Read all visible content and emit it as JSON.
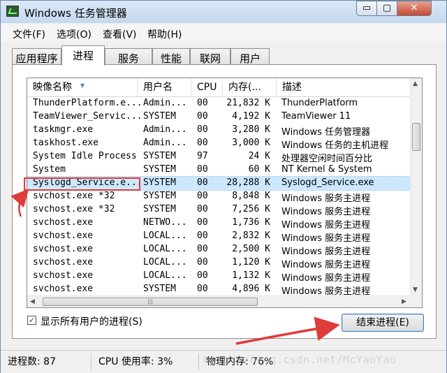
{
  "window": {
    "title": "Windows 任务管理器",
    "min_label": "▭",
    "max_label": "▢",
    "close_label": "✕"
  },
  "menu": [
    {
      "label": "文件(F)"
    },
    {
      "label": "选项(O)"
    },
    {
      "label": "查看(V)"
    },
    {
      "label": "帮助(H)"
    }
  ],
  "tabs": [
    {
      "label": "应用程序"
    },
    {
      "label": "进程",
      "active": true
    },
    {
      "label": "服务"
    },
    {
      "label": "性能"
    },
    {
      "label": "联网"
    },
    {
      "label": "用户"
    }
  ],
  "columns": [
    "映像名称",
    "用户名",
    "CPU",
    "内存(...",
    "描述"
  ],
  "processes": [
    {
      "name": "ThunderPlatform.e...",
      "user": "Admin...",
      "cpu": "00",
      "mem": "21,832 K",
      "desc": "ThunderPlatform"
    },
    {
      "name": "TeamViewer_Servic...",
      "user": "SYSTEM",
      "cpu": "00",
      "mem": "4,192 K",
      "desc": "TeamViewer 11"
    },
    {
      "name": "taskmgr.exe",
      "user": "Admin...",
      "cpu": "00",
      "mem": "3,280 K",
      "desc": "Windows 任务管理器"
    },
    {
      "name": "taskhost.exe",
      "user": "Admin...",
      "cpu": "00",
      "mem": "3,000 K",
      "desc": "Windows 任务的主机进程"
    },
    {
      "name": "System Idle Process",
      "user": "SYSTEM",
      "cpu": "97",
      "mem": "24 K",
      "desc": "处理器空闲时间百分比"
    },
    {
      "name": "System",
      "user": "SYSTEM",
      "cpu": "00",
      "mem": "60 K",
      "desc": "NT Kernel & System"
    },
    {
      "name": "Syslogd_Service.e...",
      "user": "SYSTEM",
      "cpu": "00",
      "mem": "28,288 K",
      "desc": "Syslogd_Service.exe",
      "selected": true
    },
    {
      "name": "svchost.exe *32",
      "user": "SYSTEM",
      "cpu": "00",
      "mem": "8,848 K",
      "desc": "Windows 服务主进程"
    },
    {
      "name": "svchost.exe *32",
      "user": "SYSTEM",
      "cpu": "00",
      "mem": "7,256 K",
      "desc": "Windows 服务主进程"
    },
    {
      "name": "svchost.exe",
      "user": "NETWO...",
      "cpu": "00",
      "mem": "1,736 K",
      "desc": "Windows 服务主进程"
    },
    {
      "name": "svchost.exe",
      "user": "LOCAL...",
      "cpu": "00",
      "mem": "2,832 K",
      "desc": "Windows 服务主进程"
    },
    {
      "name": "svchost.exe",
      "user": "LOCAL...",
      "cpu": "00",
      "mem": "2,500 K",
      "desc": "Windows 服务主进程"
    },
    {
      "name": "svchost.exe",
      "user": "LOCAL...",
      "cpu": "00",
      "mem": "1,120 K",
      "desc": "Windows 服务主进程"
    },
    {
      "name": "svchost.exe",
      "user": "LOCAL...",
      "cpu": "00",
      "mem": "1,132 K",
      "desc": "Windows 服务主进程"
    },
    {
      "name": "svchost.exe",
      "user": "SYSTEM",
      "cpu": "00",
      "mem": "4,896 K",
      "desc": "Windows 服务主进程"
    }
  ],
  "show_all_users": {
    "label": "显示所有用户的进程(S)",
    "checked": true
  },
  "end_process_label": "结束进程(E)",
  "status": {
    "process_count": "进程数: 87",
    "cpu_usage": "CPU 使用率: 3%",
    "memory": "物理内存: 76%"
  },
  "watermark": "http://blog.csdn.net/McYaoYao",
  "annotation_color": "#e03b3b"
}
